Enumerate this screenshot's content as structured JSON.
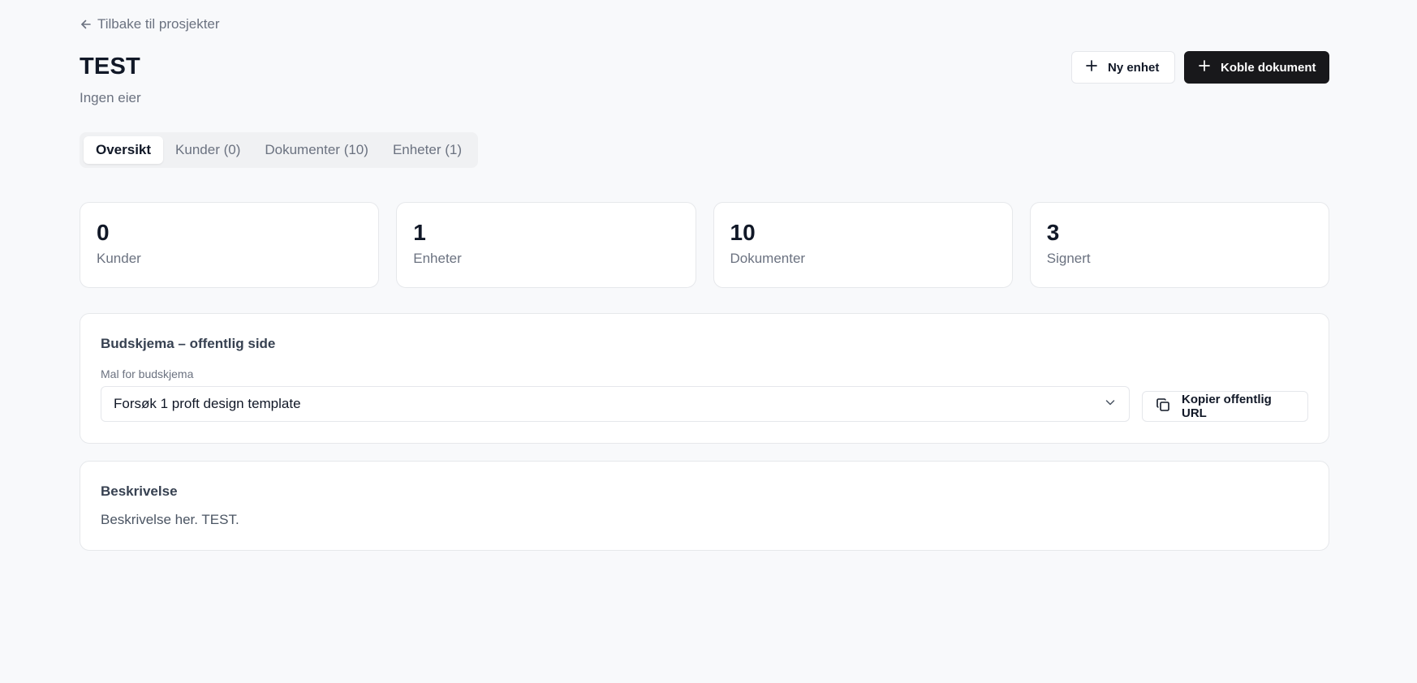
{
  "nav": {
    "back_label": "Tilbake til prosjekter"
  },
  "header": {
    "title": "TEST",
    "subtitle": "Ingen eier",
    "actions": {
      "new_unit_label": "Ny enhet",
      "link_document_label": "Koble dokument"
    }
  },
  "tabs": [
    {
      "label": "Oversikt",
      "active": true
    },
    {
      "label": "Kunder (0)",
      "active": false
    },
    {
      "label": "Dokumenter (10)",
      "active": false
    },
    {
      "label": "Enheter (1)",
      "active": false
    }
  ],
  "stats": [
    {
      "value": "0",
      "label": "Kunder"
    },
    {
      "value": "1",
      "label": "Enheter"
    },
    {
      "value": "10",
      "label": "Dokumenter"
    },
    {
      "value": "3",
      "label": "Signert"
    }
  ],
  "public_form": {
    "title": "Budskjema – offentlig side",
    "template_label": "Mal for budskjema",
    "template_selected": "Forsøk 1 proft design template",
    "copy_url_label": "Kopier offentlig URL"
  },
  "description": {
    "title": "Beskrivelse",
    "text": "Beskrivelse her. TEST."
  },
  "icons": {
    "back": "arrow-left-icon",
    "new_unit": "plus-icon",
    "link_document": "plus-icon",
    "select": "chevron-down-icon",
    "copy": "copy-icon"
  },
  "colors": {
    "background": "#f8f9fb",
    "primary_button": "#18181b",
    "text_muted": "#6b7280"
  }
}
